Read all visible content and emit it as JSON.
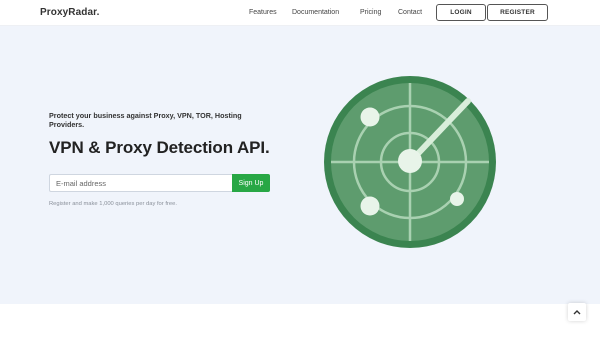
{
  "header": {
    "brand": "ProxyRadar.",
    "nav": [
      "Features",
      "Documentation",
      "Pricing",
      "Contact"
    ],
    "login_label": "LOGIN",
    "register_label": "REGISTER"
  },
  "hero": {
    "tagline": "Protect your business against Proxy, VPN, TOR, Hosting Providers.",
    "headline": "VPN & Proxy Detection API.",
    "email_placeholder": "E-mail address",
    "email_value": "",
    "signup_label": "Sign Up",
    "helper": "Register and make 1,000 queries per day for free."
  },
  "illustration": {
    "icon": "radar-icon"
  },
  "back_to_top": {
    "icon": "chevron-up-icon"
  },
  "colors": {
    "accent": "#28a745",
    "hero_bg": "#f0f4fb",
    "radar_ring": "#3b8450",
    "radar_fill": "#5e9c6e",
    "radar_lines": "#a9d1b1"
  }
}
